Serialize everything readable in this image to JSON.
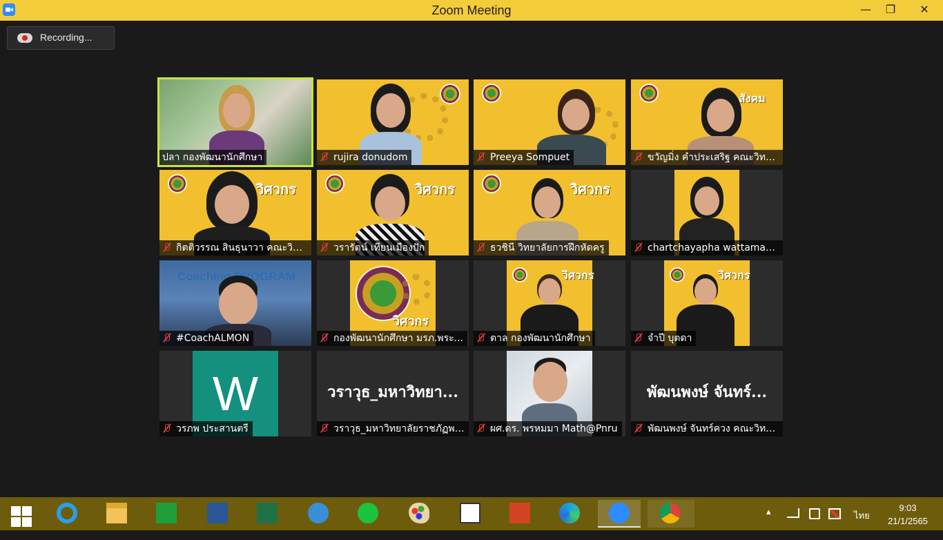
{
  "window": {
    "title": "Zoom Meeting",
    "min": "—",
    "max": "❐",
    "close": "✕"
  },
  "recording": {
    "label": "Recording..."
  },
  "participants": [
    {
      "name": "ปลา  กองพัฒนานักศึกษา",
      "muted": false
    },
    {
      "name": "rujira donudom",
      "muted": true
    },
    {
      "name": "Preeya Sompuet",
      "muted": true
    },
    {
      "name": "ขวัญมิ่ง คำประเสริฐ คณะวิทยา...",
      "muted": true
    },
    {
      "name": "กิตติวรรณ สินธุนาวา คณะวิท...",
      "muted": true
    },
    {
      "name": "วรารัตน์ เทียนเมืองปัก",
      "muted": true
    },
    {
      "name": "ธวชินี  วิทยาลัยการฝึกหัดครู",
      "muted": true
    },
    {
      "name": "chartchayapha wattamath...",
      "muted": true
    },
    {
      "name": "#CoachALMON",
      "muted": true
    },
    {
      "name": "กองพัฒนานักศึกษา มรภ.พระ...",
      "muted": true
    },
    {
      "name": "ตาล กองพัฒนานักศึกษา",
      "muted": true
    },
    {
      "name": "จำปี บุตดา",
      "muted": true
    },
    {
      "name": "วรภพ ประสานตรี",
      "muted": true
    },
    {
      "name": "วราวุธ_มหาวิทยาลัยราชภัฏพร...",
      "muted": true
    },
    {
      "name": "ผศ.ดร. พรหมมา Math@Pnru",
      "muted": true
    },
    {
      "name": "พัฒนพงษ์ จันทร์ควง คณะวิทย...",
      "muted": true
    }
  ],
  "tiles_text": {
    "logo_line1": "วิศวกร",
    "logo_line2": "สังคม",
    "coaching": "Coaching PROGRAM",
    "initial": "W",
    "big_name_1": "วราวุธ_มหาวิทยา...",
    "big_name_2": "พัฒนพงษ์ จันทร์..."
  },
  "taskbar": {
    "apps": [
      "start",
      "internet-explorer",
      "file-explorer",
      "store",
      "word",
      "excel",
      "math-input",
      "line",
      "paint",
      "lisrel",
      "powerpoint",
      "edge",
      "zoom",
      "chrome"
    ],
    "active": "zoom",
    "lang": "ไทย",
    "time": "9:03",
    "date": "21/1/2565"
  },
  "colors": {
    "titlebar": "#f3cc39",
    "taskbar": "#6d5c0c",
    "active_speaker_border": "#c8e63a",
    "muted_icon": "#e03a3a"
  }
}
